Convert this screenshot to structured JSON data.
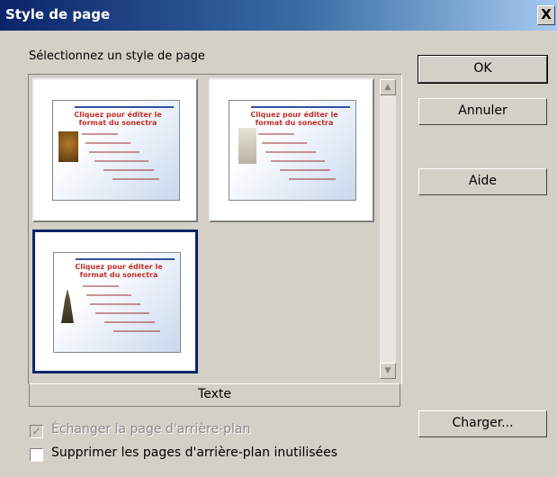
{
  "window": {
    "title": "Style de page",
    "close_label": "X"
  },
  "select_label": "Sélectionnez un style de page",
  "gallery": {
    "items": [
      {
        "heading": "Cliquez pour éditer le format du sonectra"
      },
      {
        "heading": "Cliquez pour éditer le format du sonectra"
      },
      {
        "heading": "Cliquez pour éditer le format du sonectra"
      }
    ],
    "selected_index": 2,
    "selected_name": "Texte",
    "scroll_up": "▲",
    "scroll_down": "▼"
  },
  "buttons": {
    "ok": "OK",
    "cancel": "Annuler",
    "help": "Aide",
    "load": "Charger..."
  },
  "options": {
    "exchange_background": {
      "label": "Échanger la page d'arrière-plan",
      "checked": true,
      "disabled": true
    },
    "delete_unused": {
      "label": "Supprimer les pages d'arrière-plan inutilisées",
      "checked": false,
      "disabled": false
    }
  }
}
